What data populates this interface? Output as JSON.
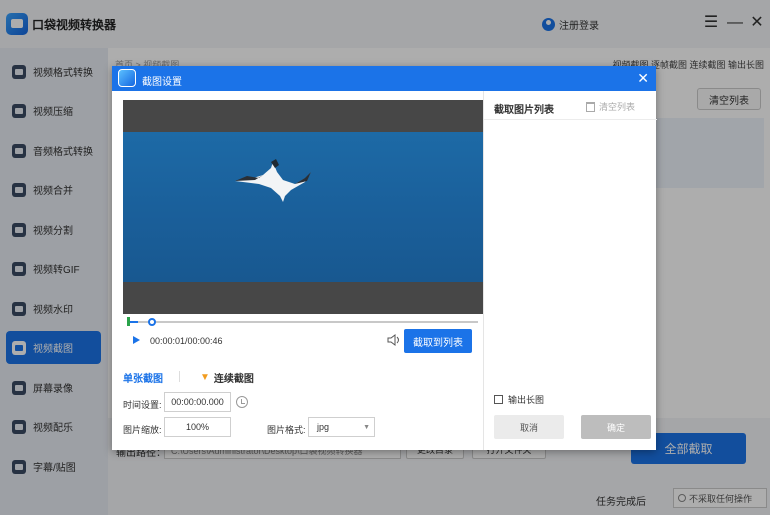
{
  "app": {
    "title": "口袋视频转换器",
    "login": "注册登录"
  },
  "window_controls": {
    "menu": "☰",
    "minimize": "—",
    "close": "✕"
  },
  "sidebar": {
    "items": [
      {
        "label": "视频格式转换",
        "icon": "video-convert-icon"
      },
      {
        "label": "视频压缩",
        "icon": "compress-icon"
      },
      {
        "label": "音频格式转换",
        "icon": "audio-convert-icon"
      },
      {
        "label": "视频合并",
        "icon": "merge-icon"
      },
      {
        "label": "视频分割",
        "icon": "split-icon"
      },
      {
        "label": "视频转GIF",
        "icon": "gif-icon"
      },
      {
        "label": "视频水印",
        "icon": "watermark-icon"
      },
      {
        "label": "视频截图",
        "icon": "screenshot-icon",
        "active": true
      },
      {
        "label": "屏幕录像",
        "icon": "screen-record-icon"
      },
      {
        "label": "视频配乐",
        "icon": "music-icon"
      },
      {
        "label": "字幕/贴图",
        "icon": "subtitle-icon"
      }
    ]
  },
  "main": {
    "breadcrumb": "首页 > 视频截图",
    "top_links": "视频截图  逐帧截图  连续截图  输出长图",
    "clear_list": "清空列表",
    "output_label": "输出路径：",
    "output_path": "C:\\Users\\Administrator\\Desktop\\口袋视频转换器",
    "change_dir": "更改目录",
    "open_folder": "打开文件夹",
    "capture_all": "全部截取",
    "task_label": "任务完成后",
    "task_option": "不采取任何操作"
  },
  "dialog": {
    "title": "截图设置",
    "close": "✕",
    "time_readout": "00:00:01/00:00:46",
    "progress": 0.03,
    "add_to_list": "截取到列表",
    "tab_single": "单张截图",
    "tab_continuous": "连续截图",
    "time_label": "时间设置:",
    "time_value": "00:00:00.000",
    "scale_label": "图片缩放:",
    "scale_value": "100%",
    "format_label": "图片格式:",
    "format_value": "jpg",
    "list_title": "截取图片列表",
    "clear_list": "清空列表",
    "long_image": "输出长图",
    "cancel": "取消",
    "ok": "确定"
  },
  "colors": {
    "accent": "#1b73e8",
    "sidebar_bg": "#e8ecf3",
    "dialog_header": "#1b73e8"
  }
}
